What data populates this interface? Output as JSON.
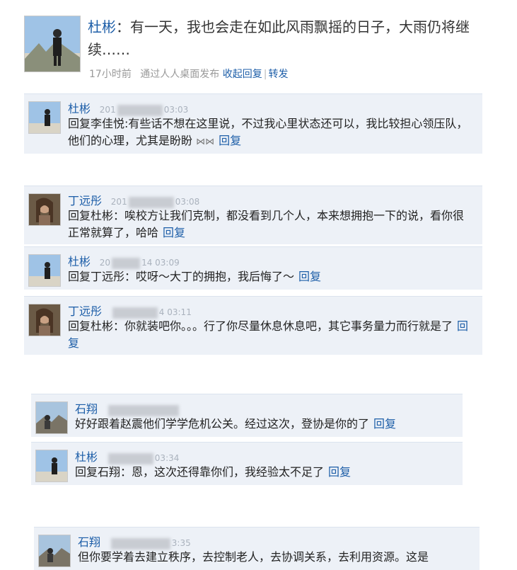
{
  "post": {
    "author": "杜彬",
    "text": "：有一天，我也会走在如此风雨飘摇的日子，大雨仍将继续……",
    "time": "17小时前",
    "source": "通过人人桌面发布",
    "collapse_label": "收起回复",
    "share_label": "转发"
  },
  "comments": [
    {
      "name": "杜彬",
      "time_left": "201",
      "time_right": "03:03",
      "text": "回复李佳悦:有些话不想在这里说，不过我心里状态还可以，我比较担心领压队，他们的心理，尤其是盼盼",
      "emoticon": "⋈⋈",
      "reply": "回复"
    },
    {
      "name": "丁远彤",
      "time_left": "201",
      "time_right": "03:08",
      "text": "回复杜彬：唉校方让我们克制，都没看到几个人，本来想拥抱一下的说，看你很正常就算了，哈哈",
      "reply": "回复"
    },
    {
      "name": "杜彬",
      "time_left": "20",
      "time_right": "14 03:09",
      "text": "回复丁远彤：哎呀～大丁的拥抱，我后悔了～",
      "reply": "回复"
    },
    {
      "name": "丁远彤",
      "time_left": "",
      "time_right": "4 03:11",
      "text": "回复杜彬：你就装吧你。。。行了你尽量休息休息吧，其它事务量力而行就是了",
      "reply": "回复"
    },
    {
      "name": "石翔",
      "time_left": "",
      "time_right": "",
      "text": "好好跟着赵震他们学学危机公关。经过这次，登协是你的了",
      "reply": "回复"
    },
    {
      "name": "杜彬",
      "time_left": "",
      "time_right": "03:34",
      "text": "回复石翔：恩，这次还得靠你们，我经验太不足了",
      "reply": "回复"
    },
    {
      "name": "石翔",
      "time_left": "",
      "time_right": "3:35",
      "text": "但你要学着去建立秩序，去控制老人，去协调关系，去利用资源。这是",
      "reply": ""
    }
  ]
}
